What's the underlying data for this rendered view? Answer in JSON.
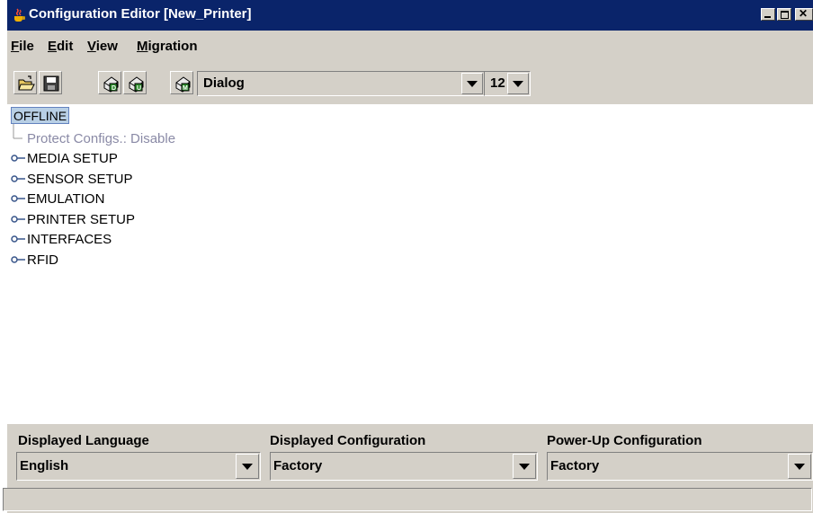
{
  "window": {
    "title": "Configuration Editor [New_Printer]",
    "controls": [
      "minimize-icon",
      "maximize-icon",
      "close-icon"
    ]
  },
  "menubar": {
    "items": [
      {
        "label": "File",
        "accel": "F",
        "rest": "ile"
      },
      {
        "label": "Edit",
        "accel": "E",
        "rest": "dit"
      },
      {
        "label": "View",
        "accel": "V",
        "rest": "iew"
      },
      {
        "label": "Migration",
        "accel": "M",
        "rest": "igration"
      }
    ]
  },
  "toolbar": {
    "buttons": [
      "open-folder-icon",
      "save-icon",
      "printer-download-icon",
      "printer-upload-icon",
      "printer-migrate-icon"
    ],
    "font_name": "Dialog",
    "font_size": "12"
  },
  "tree": {
    "root": "OFFLINE",
    "nodes": [
      {
        "label": "Protect Configs.: Disable",
        "disabled": true
      },
      {
        "label": "MEDIA SETUP"
      },
      {
        "label": "SENSOR SETUP"
      },
      {
        "label": "EMULATION"
      },
      {
        "label": "PRINTER SETUP"
      },
      {
        "label": "INTERFACES"
      },
      {
        "label": "RFID"
      }
    ]
  },
  "config": {
    "language_label": "Displayed Language",
    "language_value": "English",
    "displayed_label": "Displayed Configuration",
    "displayed_value": "Factory",
    "powerup_label": "Power-Up Configuration",
    "powerup_value": "Factory"
  },
  "status": {
    "text": ""
  },
  "colors": {
    "titlebar": "#0a246a",
    "chrome": "#d4d0c8",
    "selection": "#b8cfe5",
    "disabled_text": "#8a8aa6"
  }
}
